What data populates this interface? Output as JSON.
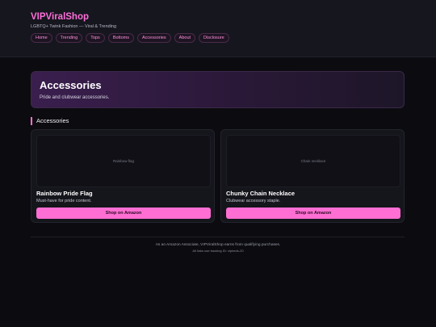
{
  "site": {
    "brand": "VIPViralShop",
    "tagline": "LGBTQ+ Twink Fashion — Viral & Trending"
  },
  "nav": [
    "Home",
    "Trending",
    "Tops",
    "Bottoms",
    "Accessories",
    "About",
    "Disclosure"
  ],
  "hero": {
    "title": "Accessories",
    "subtitle": "Pride and clubwear accessories."
  },
  "section": {
    "title": "Accessories"
  },
  "products": [
    {
      "image_label": "Rainbow flag",
      "title": "Rainbow Pride Flag",
      "description": "Must-have for pride content.",
      "button": "Shop on Amazon"
    },
    {
      "image_label": "Chain necklace",
      "title": "Chunky Chain Necklace",
      "description": "Clubwear accessory staple.",
      "button": "Shop on Amazon"
    }
  ],
  "footer": {
    "line1": "As an Amazon Associate, VIPViralShop earns from qualifying purchases.",
    "line2": "All links use tracking ID: vipbeds-20"
  },
  "colors": {
    "accent": "#ff6fd8",
    "button": "#ff6fd3",
    "background": "#0c0c10"
  }
}
